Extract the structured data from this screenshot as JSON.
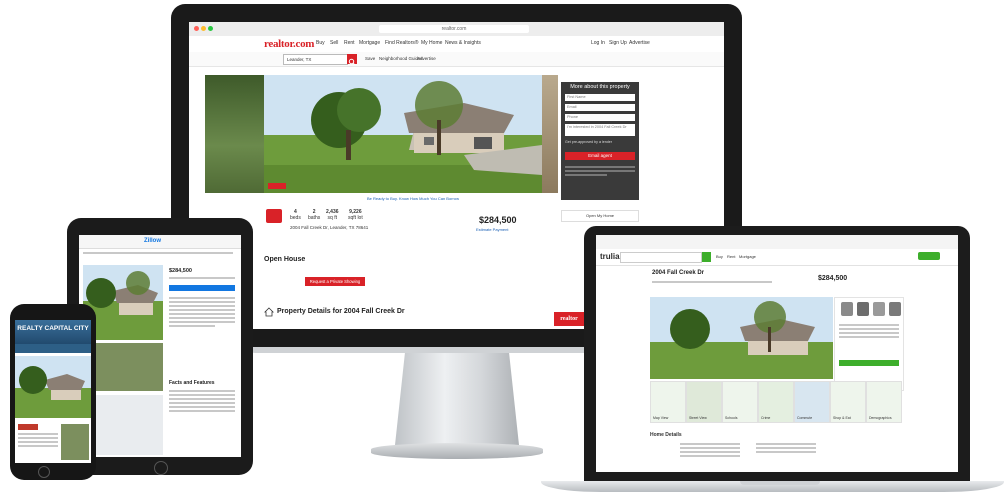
{
  "imac": {
    "url": "realtor.com",
    "logo": "realtor.com",
    "nav": [
      "Buy",
      "Sell",
      "Rent",
      "Mortgage",
      "Find Realtors®",
      "My Home",
      "News & Insights"
    ],
    "nav_right": [
      "Log In",
      "Sign Up",
      "Advertise"
    ],
    "search_value": "Leander, TX",
    "sub_links": [
      "Save",
      "Neighborhood Guides",
      "Advertise"
    ],
    "form": {
      "title": "More about this property",
      "fields": [
        "First Name",
        "Email",
        "Phone"
      ],
      "message": "I'm interested in 2004 Fall Creek Dr",
      "checkbox_label": "Get pre-approved by a lender",
      "button": "Email agent"
    },
    "stats": [
      {
        "value": "4",
        "label": "beds"
      },
      {
        "value": "2",
        "label": "baths"
      },
      {
        "value": "2,436",
        "label": "sq ft"
      },
      {
        "value": "9,226",
        "label": "sqft lot"
      }
    ],
    "address": "2004 Fall Creek Dr, Leander, TX 78641",
    "price": "$284,500",
    "estimate_link": "Estimate Payment",
    "see_home": "Open My Home",
    "ready_link": "Be Ready to Buy. Know How Much You Can Borrow",
    "open_house": "Open House",
    "request_button": "Request a Private Showing",
    "details_heading": "Property Details for 2004 Fall Creek Dr",
    "badge": "realtor"
  },
  "laptop": {
    "logo": "trulia",
    "nav": [
      "Buy",
      "Rent",
      "Mortgage"
    ],
    "address": "2004 Fall Creek Dr",
    "price": "$284,500",
    "tiles": [
      "Map View",
      "Street View",
      "Schools",
      "Crime",
      "Commute",
      "Shop & Eat",
      "Demographics"
    ],
    "section": "Home Details"
  },
  "tablet": {
    "logo": "Zillow",
    "price": "$284,500",
    "facts_heading": "Facts and Features"
  },
  "phone": {
    "banner_left": "REALTY",
    "banner_right": "CAPITAL CITY"
  },
  "colors": {
    "realtor_red": "#d92228",
    "trulia_green": "#3dae2b",
    "zillow_blue": "#1277e1"
  }
}
